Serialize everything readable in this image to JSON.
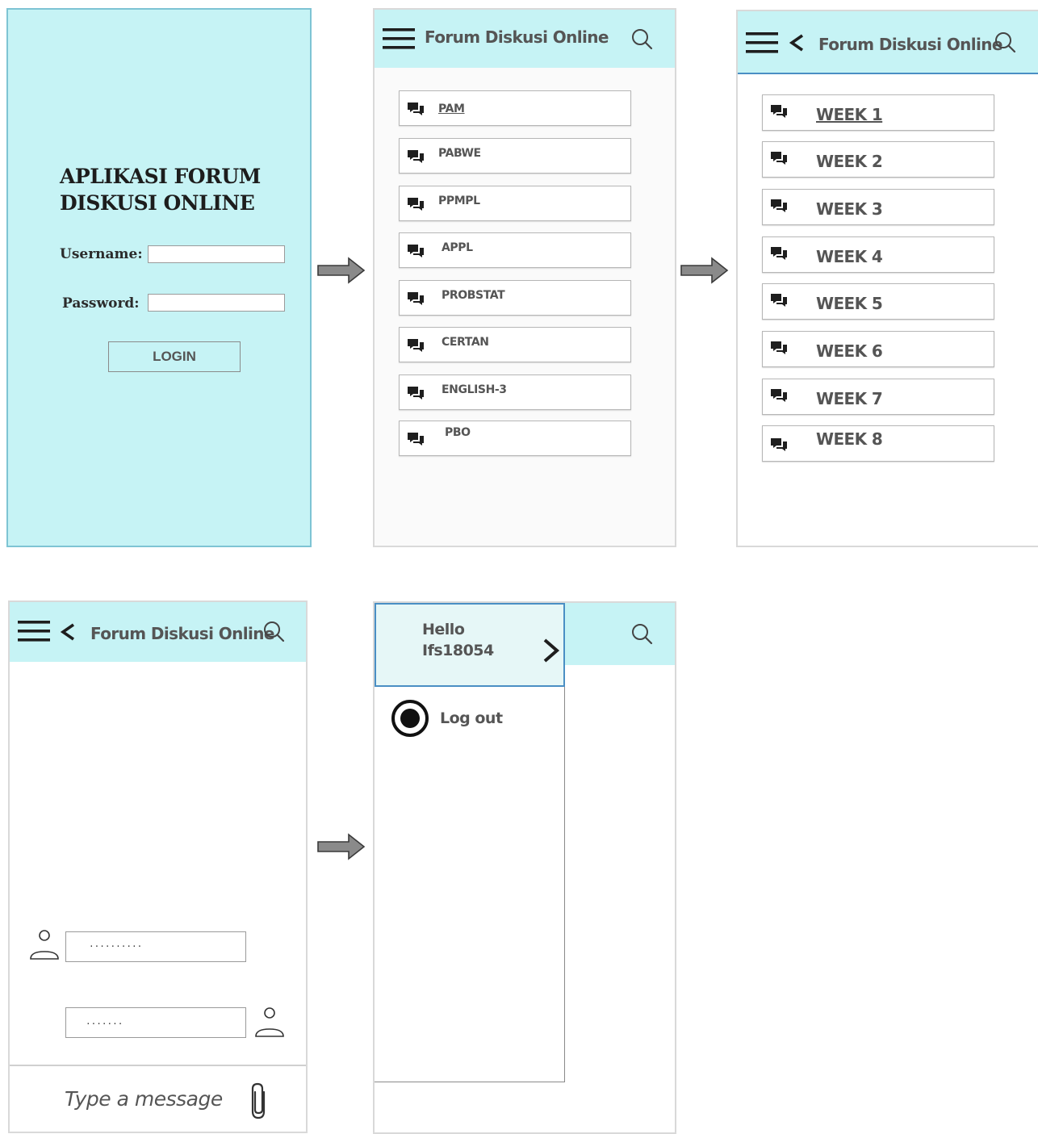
{
  "login": {
    "title_line1": "APLIKASI FORUM",
    "title_line2": "DISKUSI ONLINE",
    "username_label": "Username:",
    "password_label": "Password:",
    "login_button": "LOGIN"
  },
  "header": {
    "title": "Forum Diskusi Online"
  },
  "courses": [
    "PAM",
    "PABWE",
    "PPMPL",
    "APPL",
    "PROBSTAT",
    "CERTAN",
    "ENGLISH-3",
    "PBO"
  ],
  "weeks": [
    "WEEK 1",
    "WEEK 2",
    "WEEK 3",
    "WEEK 4",
    "WEEK 5",
    "WEEK 6",
    "WEEK 7",
    "WEEK 8"
  ],
  "chat": {
    "message1": "..........",
    "message2": ".......",
    "placeholder": "Type a message"
  },
  "drawer": {
    "greeting_line1": "Hello",
    "greeting_line2": "Ifs18054",
    "logout": "Log out"
  },
  "colors": {
    "header_bg": "#c6f3f5",
    "accent_border": "#4a8fc4"
  },
  "icons": [
    "hamburger-icon",
    "back-chevron-icon",
    "search-icon",
    "chat-bubbles-icon",
    "user-icon",
    "paperclip-icon",
    "chevron-right-icon",
    "radio-selected-icon",
    "arrow-right-icon"
  ]
}
